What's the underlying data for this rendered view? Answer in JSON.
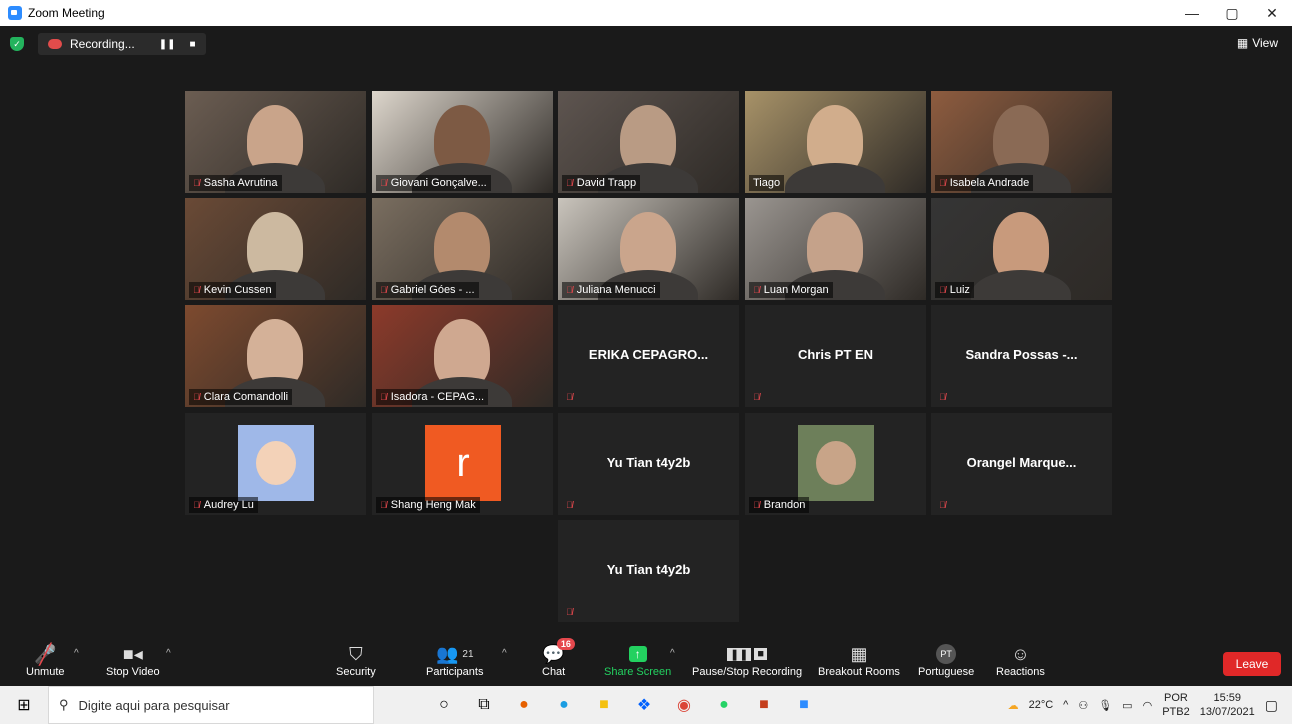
{
  "window": {
    "title": "Zoom Meeting",
    "controls": [
      "—",
      "▢",
      "✕"
    ]
  },
  "topbar": {
    "recording_label": "Recording...",
    "view_label": "View"
  },
  "participants_grid": [
    {
      "name": "Sasha Avrutina",
      "type": "video"
    },
    {
      "name": "Giovani Gonçalve...",
      "type": "video"
    },
    {
      "name": "David Trapp",
      "type": "video"
    },
    {
      "name": "Tiago",
      "type": "video",
      "active": true
    },
    {
      "name": "Isabela Andrade",
      "type": "video"
    },
    {
      "name": "Kevin Cussen",
      "type": "video"
    },
    {
      "name": "Gabriel Góes - ...",
      "type": "video"
    },
    {
      "name": "Juliana Menucci",
      "type": "video"
    },
    {
      "name": "Luan Morgan",
      "type": "video"
    },
    {
      "name": "Luiz",
      "type": "video"
    },
    {
      "name": "Clara Comandolli",
      "type": "video"
    },
    {
      "name": "Isadora - CEPAG...",
      "type": "video"
    },
    {
      "name": "ERIKA CEPAGRO...",
      "type": "name"
    },
    {
      "name": "Chris PT EN",
      "type": "name"
    },
    {
      "name": "Sandra Possas -...",
      "type": "name"
    },
    {
      "name": "Audrey Lu",
      "type": "avatar"
    },
    {
      "name": "Shang Heng Mak",
      "type": "letter",
      "letter": "r"
    },
    {
      "name": "Yu Tian t4y2b",
      "type": "name"
    },
    {
      "name": "Brandon",
      "type": "avatar"
    },
    {
      "name": "Orangel  Marque...",
      "type": "name"
    },
    {
      "name": "Yu Tian t4y2b",
      "type": "name"
    }
  ],
  "toolbar": {
    "unmute": "Unmute",
    "stop_video": "Stop Video",
    "security": "Security",
    "participants": "Participants",
    "participants_count": "21",
    "chat": "Chat",
    "chat_badge": "16",
    "share_screen": "Share Screen",
    "pause_stop_recording": "Pause/Stop Recording",
    "breakout_rooms": "Breakout Rooms",
    "portuguese": "Portuguese",
    "portuguese_badge": "PT",
    "reactions": "Reactions",
    "leave": "Leave"
  },
  "taskbar": {
    "search_placeholder": "Digite aqui para pesquisar",
    "weather": "22°C",
    "lang_top": "POR",
    "lang_bottom": "PTB2",
    "time": "15:59",
    "date": "13/07/2021"
  },
  "colors": {
    "active_speaker": "#c8d93a",
    "leave": "#e02828",
    "share_green": "#23d160",
    "muted_red": "#e5484d"
  }
}
